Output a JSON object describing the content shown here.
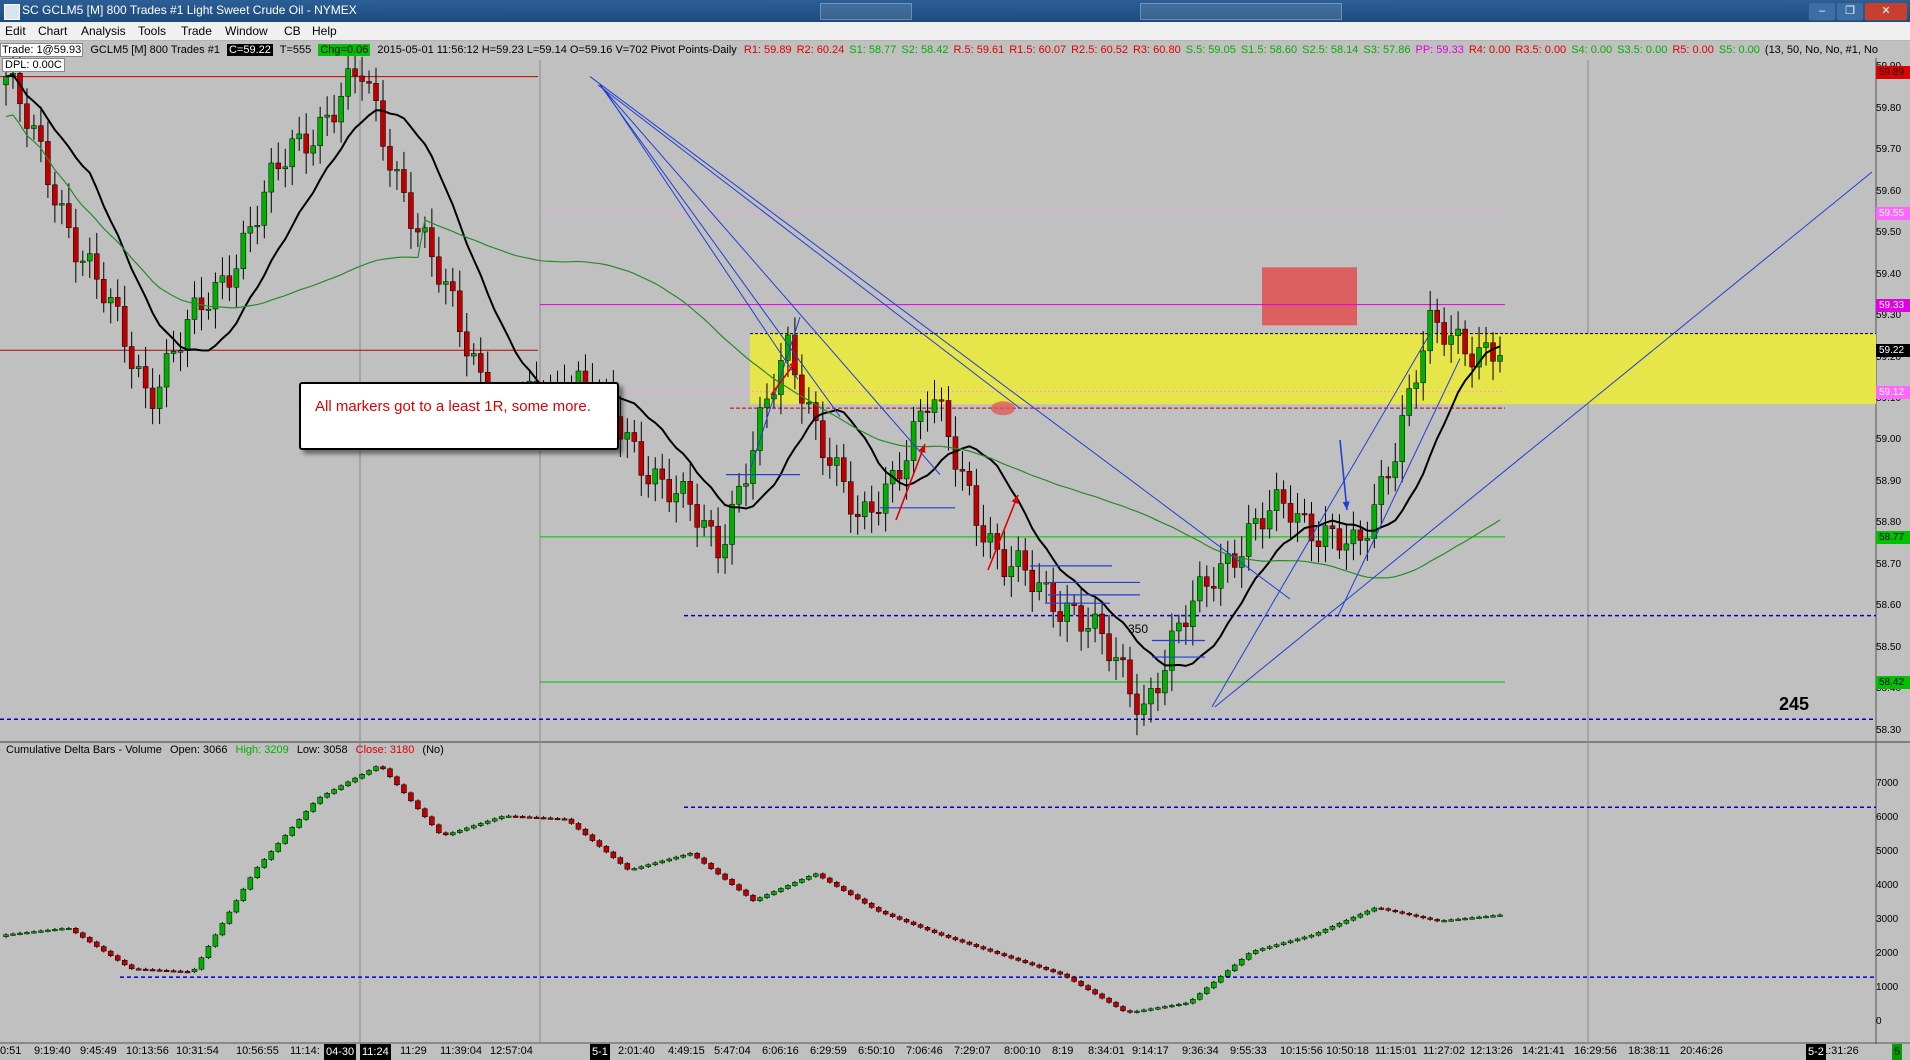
{
  "window": {
    "title": "SC GCLM5 [M]  800 Trades  #1  Light Sweet Crude Oil - NYMEX",
    "min_glyph": "–",
    "max_glyph": "❐",
    "close_glyph": "✕"
  },
  "menu": [
    "Edit",
    "Chart",
    "Analysis",
    "Tools",
    "Trade",
    "Window",
    "CB",
    "Help"
  ],
  "header": {
    "trade": "Trade: 1@59.93",
    "symbol": "GCLM5 [M]  800 Trades  #1",
    "close": "C=59.22",
    "total": "T=555",
    "change": "Chg=0.06",
    "datetime_ohl": "2015-05-01 11:56:12 H=59.23 L=59.14 O=59.16 V=702 Pivot Points-Daily",
    "pivots": [
      {
        "text": "R1: 59.89",
        "color": "#e00000"
      },
      {
        "text": "R2: 60.24",
        "color": "#e00000"
      },
      {
        "text": "S1: 58.77",
        "color": "#00b000"
      },
      {
        "text": "S2: 58.42",
        "color": "#00b000"
      },
      {
        "text": "R.5: 59.61",
        "color": "#e00000"
      },
      {
        "text": "R1.5: 60.07",
        "color": "#e00000"
      },
      {
        "text": "R2.5: 60.52",
        "color": "#e00000"
      },
      {
        "text": "R3: 60.80",
        "color": "#e00000"
      },
      {
        "text": "S.5: 59.05",
        "color": "#00b000"
      },
      {
        "text": "S1.5: 58.60",
        "color": "#00b000"
      },
      {
        "text": "S2.5: 58.14",
        "color": "#00b000"
      },
      {
        "text": "S3: 57.86",
        "color": "#00b000"
      },
      {
        "text": "PP: 59.33",
        "color": "#e000e0"
      },
      {
        "text": "R4: 0.00",
        "color": "#e00000"
      },
      {
        "text": "R3.5: 0.00",
        "color": "#e00000"
      },
      {
        "text": "S4: 0.00",
        "color": "#00b000"
      },
      {
        "text": "S3.5: 0.00",
        "color": "#00b000"
      },
      {
        "text": "R5: 0.00",
        "color": "#e00000"
      },
      {
        "text": "S5: 0.00",
        "color": "#00b000"
      },
      {
        "text": "(13, 50, No, No, #1, No",
        "color": "#000000"
      }
    ],
    "dpl": "DPL: 0.00C"
  },
  "lower_panel": {
    "name": "Cumulative Delta Bars - Volume",
    "open": "Open: 3066",
    "high": "High: 3209",
    "low": "Low: 3058",
    "close": "Close: 3180",
    "flag": "(No)"
  },
  "annotation": "All markers got to a least 1R, some more.",
  "labels": {
    "l350": "350",
    "l245": "245"
  },
  "price_axis": [
    "59.90",
    "59.80",
    "59.70",
    "59.60",
    "59.50",
    "59.40",
    "59.30",
    "59.20",
    "59.10",
    "59.00",
    "58.90",
    "58.80",
    "58.70",
    "58.60",
    "58.50",
    "58.40",
    "58.30"
  ],
  "price_tags": [
    {
      "text": "59.89",
      "bg": "#e00000",
      "fg": "#000000"
    },
    {
      "text": "59.55",
      "bg": "#ff66ff",
      "fg": "#ffffff"
    },
    {
      "text": "59.33",
      "bg": "#e000e0",
      "fg": "#ffffff"
    },
    {
      "text": "59.22",
      "bg": "#000000",
      "fg": "#ffffff"
    },
    {
      "text": "59.12",
      "bg": "#ff66ff",
      "fg": "#ffffff"
    },
    {
      "text": "58.77",
      "bg": "#00c000",
      "fg": "#000000"
    },
    {
      "text": "58.42",
      "bg": "#00c000",
      "fg": "#000000"
    }
  ],
  "delta_axis": [
    "7000",
    "6000",
    "5000",
    "4000",
    "3000",
    "2000",
    "1000",
    "0"
  ],
  "time_axis": [
    "0:51",
    "9:19:40",
    "9:45:49",
    "10:13:56",
    "10:31:54",
    "10:56:55",
    "11:14:",
    "11:29",
    "11:39:04",
    "12:57:04",
    "2:01:40",
    "4:49:15",
    "5:47:04",
    "6:06:16",
    "6:29:59",
    "6:50:10",
    "7:06:46",
    "7:29:07",
    "8:00:10",
    "8:19",
    "8:34:01",
    "9:14:17",
    "9:36:34",
    "9:55:33",
    "10:15:56",
    "10:50:18",
    "11:15:01",
    "11:27:02",
    "12:13:26",
    "14:21:41",
    "16:29:56",
    "18:38:11",
    "20:46:26",
    "1:31:26"
  ],
  "time_marks": [
    "04-30",
    "11:24",
    "5-1",
    "5-2",
    "5"
  ],
  "colors": {
    "up": "#00b000",
    "down": "#c00000",
    "zone": "#e6e64a",
    "sma": "#000000",
    "sma_long": "#2a8a2a",
    "trend": "#1f3fd6",
    "arrow": "#e00000"
  },
  "chart_data": {
    "type": "candlestick",
    "symbol": "GCLM5",
    "last": 59.22,
    "ylim": [
      58.28,
      59.92
    ],
    "levels": {
      "pivot_pp": 59.33,
      "s1": 58.77,
      "s2": 58.42,
      "r1": 59.89,
      "zone_top": 59.26,
      "zone_bottom": 59.09
    },
    "key_prices": [
      59.88,
      59.48,
      59.12,
      59.38,
      59.7,
      59.88,
      59.42,
      59.05,
      59.16,
      58.95,
      58.75,
      59.22,
      58.78,
      59.1,
      58.7,
      58.6,
      58.37,
      58.7,
      58.85,
      58.72,
      59.26,
      59.22
    ],
    "delta_ylim": [
      -500,
      7800
    ],
    "delta_key": [
      2600,
      2800,
      1600,
      1500,
      4500,
      6600,
      7600,
      5500,
      6100,
      6000,
      4500,
      5000,
      3600,
      4400,
      3300,
      2600,
      2000,
      1400,
      300,
      600,
      2100,
      2600,
      3400,
      3000,
      3180
    ]
  }
}
